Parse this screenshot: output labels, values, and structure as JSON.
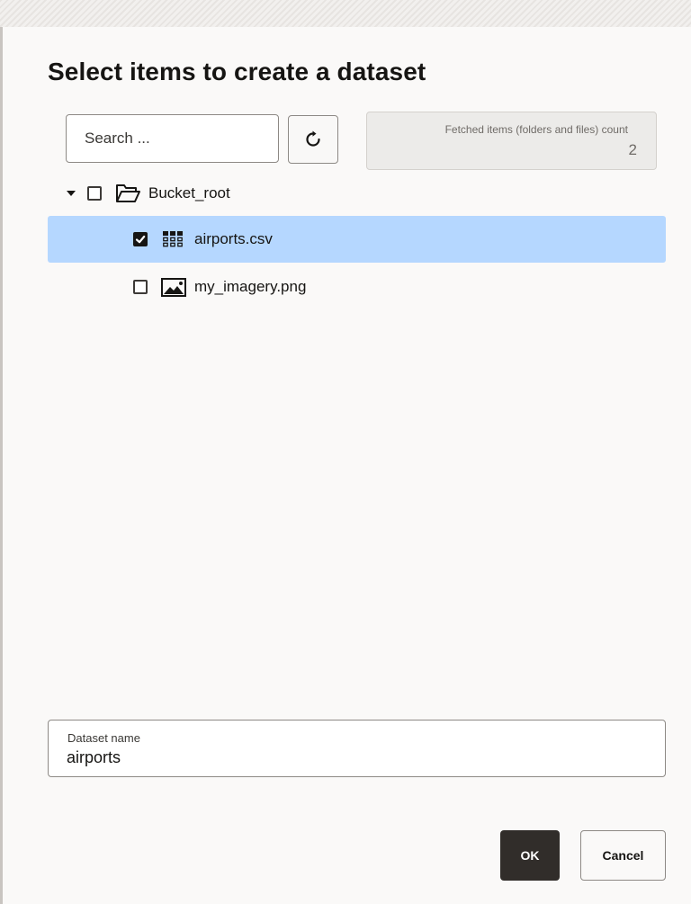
{
  "dialog": {
    "title": "Select items to create a dataset"
  },
  "toolbar": {
    "search_placeholder": "Search ...",
    "search_value": "",
    "refresh_icon": "refresh-icon",
    "count_label": "Fetched items (folders and files) count",
    "count_value": "2"
  },
  "tree": {
    "root": {
      "label": "Bucket_root",
      "expanded": true,
      "checked": false,
      "icon": "folder-open-icon"
    },
    "items": [
      {
        "label": "airports.csv",
        "checked": true,
        "selected": true,
        "icon": "table-grid-icon"
      },
      {
        "label": "my_imagery.png",
        "checked": false,
        "selected": false,
        "icon": "image-icon"
      }
    ]
  },
  "dataset_name": {
    "label": "Dataset name",
    "value": "airports"
  },
  "actions": {
    "ok_label": "OK",
    "cancel_label": "Cancel"
  },
  "colors": {
    "selected_row": "#b5d7ff",
    "primary_button": "#312d2a",
    "background": "#faf9f8"
  }
}
